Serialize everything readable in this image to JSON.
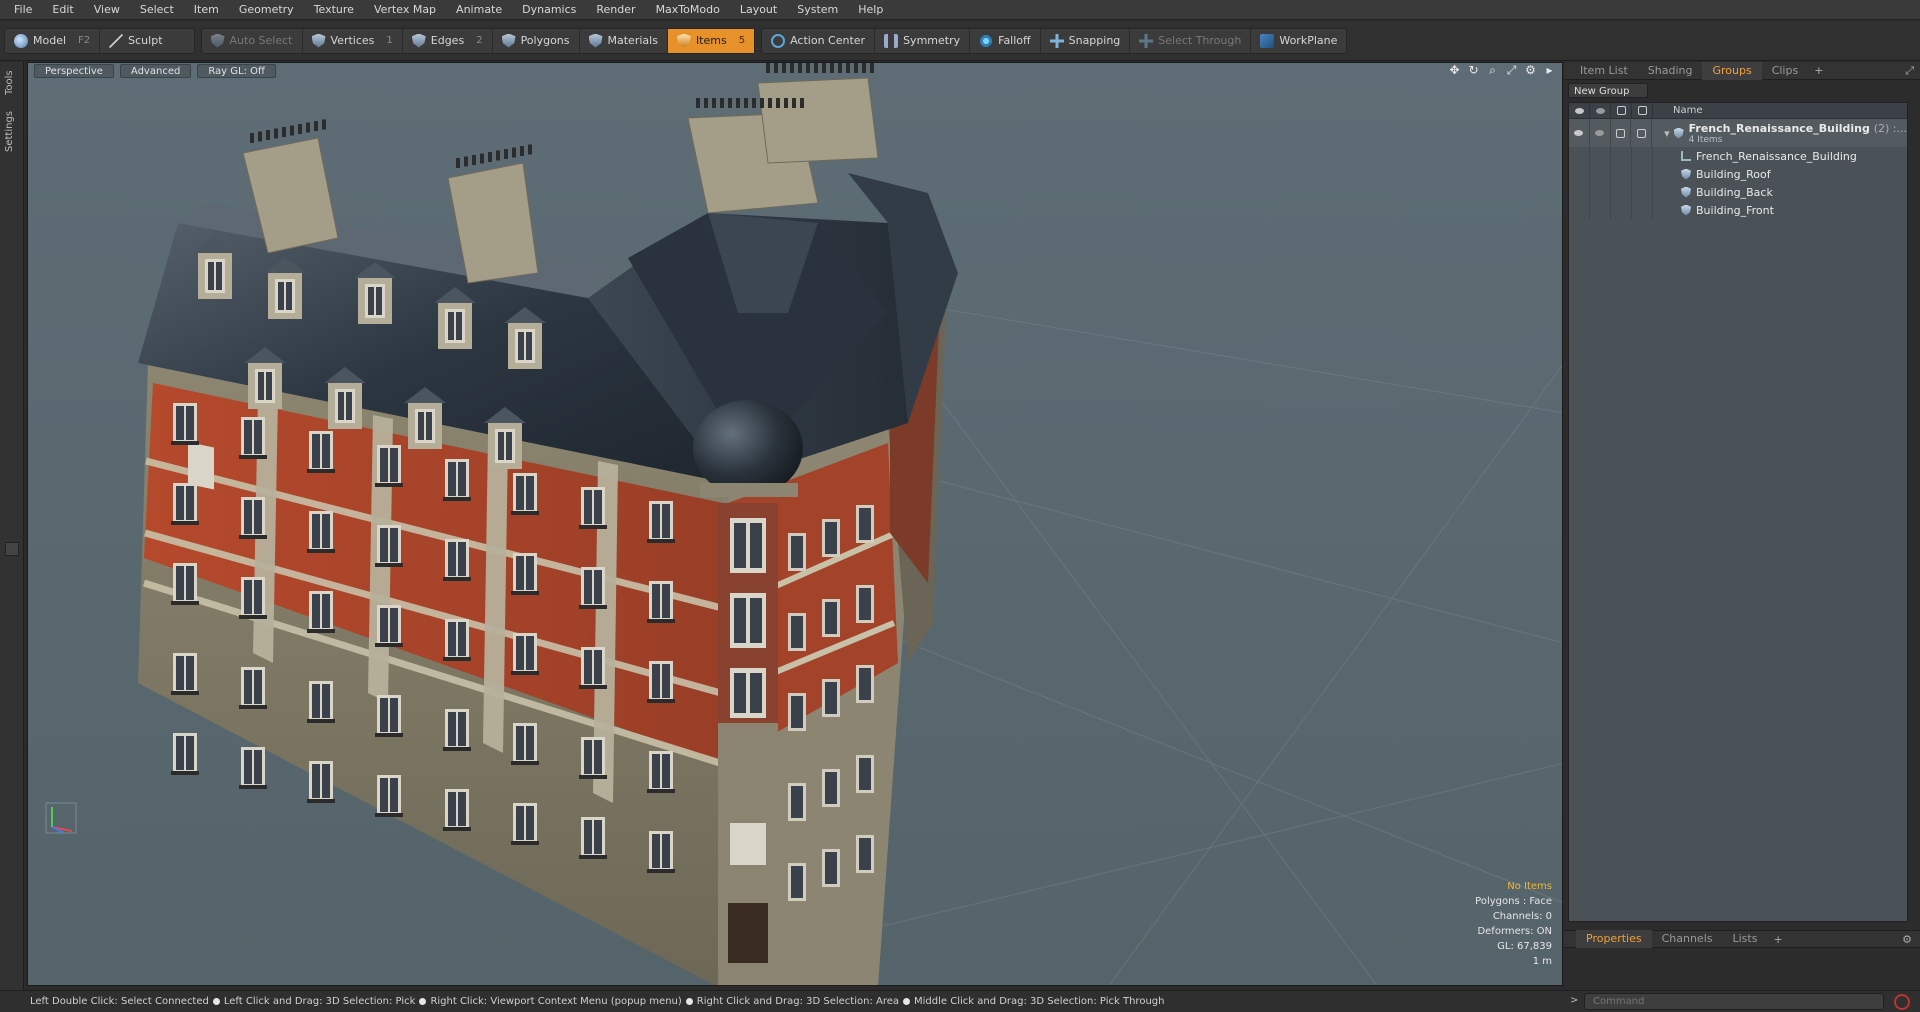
{
  "menu": [
    "File",
    "Edit",
    "View",
    "Select",
    "Item",
    "Geometry",
    "Texture",
    "Vertex Map",
    "Animate",
    "Dynamics",
    "Render",
    "MaxToModo",
    "Layout",
    "System",
    "Help"
  ],
  "toolbar": {
    "model": {
      "label": "Model",
      "hotkey": "F2"
    },
    "sculpt": {
      "label": "Sculpt"
    },
    "auto_select": {
      "label": "Auto Select"
    },
    "vertices": {
      "label": "Vertices",
      "hotkey": "1"
    },
    "edges": {
      "label": "Edges",
      "hotkey": "2"
    },
    "polygons": {
      "label": "Polygons"
    },
    "materials": {
      "label": "Materials"
    },
    "items": {
      "label": "Items",
      "hotkey": "5"
    },
    "action_center": {
      "label": "Action Center"
    },
    "symmetry": {
      "label": "Symmetry"
    },
    "falloff": {
      "label": "Falloff"
    },
    "snapping": {
      "label": "Snapping"
    },
    "select_through": {
      "label": "Select Through"
    },
    "workplane": {
      "label": "WorkPlane"
    }
  },
  "left_strip": {
    "tools": "Tools",
    "settings": "Settings"
  },
  "viewport": {
    "view_mode": "Perspective",
    "shading": "Advanced",
    "raygl": "Ray GL: Off",
    "info": {
      "selection": "No Items",
      "polygons": "Polygons : Face",
      "channels": "Channels: 0",
      "deformers": "Deformers: ON",
      "gl": "GL: 67,839",
      "scale": "1 m"
    }
  },
  "right_panel": {
    "tabs": [
      "Item List",
      "Shading",
      "Groups",
      "Clips"
    ],
    "active_tab": "Groups",
    "new_group_label": "New Group",
    "column_name": "Name",
    "root": {
      "name": "French_Renaissance_Building",
      "count": "(2) :...",
      "subnote": "4 Items"
    },
    "children": [
      "French_Renaissance_Building",
      "Building_Roof",
      "Building_Back",
      "Building_Front"
    ],
    "bottom_tabs": [
      "Properties",
      "Channels",
      "Lists"
    ],
    "command_placeholder": "Command"
  },
  "statusbar": [
    "Left Double Click: Select Connected",
    "Left Click and Drag: 3D Selection: Pick",
    "Right Click: Viewport Context Menu (popup menu)",
    "Right Click and Drag: 3D Selection: Area",
    "Middle Click and Drag: 3D Selection: Pick Through"
  ],
  "colors": {
    "accent": "#e7912a",
    "viewport_bg": "#5c6b73",
    "roof": "#2f3a45",
    "brick": "#b04a2e",
    "stone": "#8f8870"
  }
}
